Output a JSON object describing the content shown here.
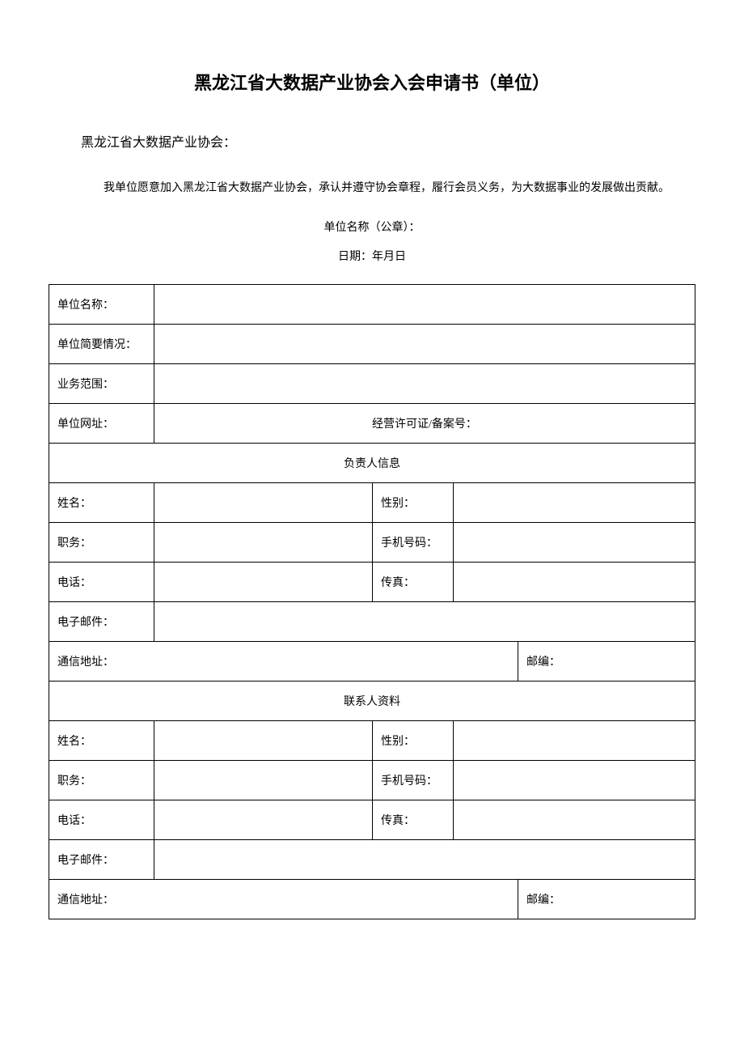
{
  "title": "黑龙江省大数据产业协会入会申请书（单位）",
  "addressee": "黑龙江省大数据产业协会：",
  "body": "我单位愿意加入黑龙江省大数据产业协会，承认并遵守协会章程，履行会员义务，为大数据事业的发展做出贡献。",
  "signature_label": "单位名称（公章）：",
  "date_label": "日期：年月日",
  "table": {
    "unit_name": "单位名称：",
    "unit_summary": "单位简要情况：",
    "business_scope": "业务范围：",
    "website": "单位网址：",
    "license": "经营许可证/备案号：",
    "leader_section": "负责人信息",
    "name": "姓名：",
    "gender": "性别：",
    "position": "职务：",
    "mobile": "手机号码：",
    "phone": "电话：",
    "fax": "传真：",
    "email": "电子邮件：",
    "address": "通信地址：",
    "postcode": "邮编：",
    "contact_section": "联系人资料"
  }
}
